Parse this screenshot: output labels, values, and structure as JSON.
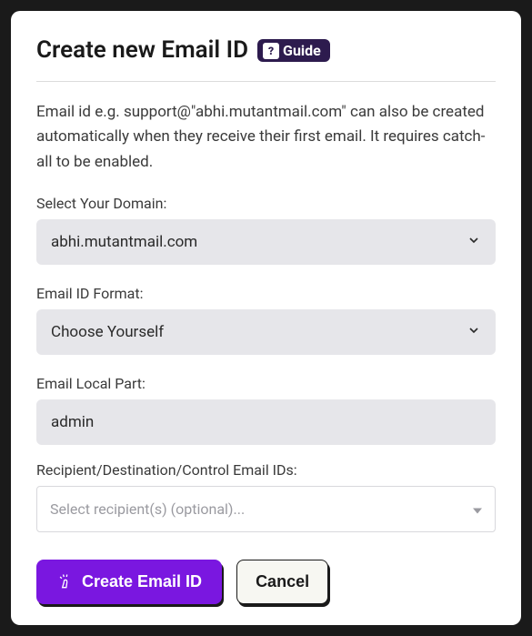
{
  "header": {
    "title": "Create new Email ID",
    "guide_label": "Guide"
  },
  "description": "Email id e.g. support@\"abhi.mutantmail.com\" can also be created automatically when they receive their first email. It requires catch-all to be enabled.",
  "fields": {
    "domain": {
      "label": "Select Your Domain:",
      "value": "abhi.mutantmail.com"
    },
    "format": {
      "label": "Email ID Format:",
      "value": "Choose Yourself"
    },
    "local_part": {
      "label": "Email Local Part:",
      "value": "admin"
    },
    "recipients": {
      "label": "Recipient/Destination/Control Email IDs:",
      "placeholder": "Select recipient(s) (optional)..."
    }
  },
  "buttons": {
    "submit": "Create Email ID",
    "cancel": "Cancel"
  }
}
